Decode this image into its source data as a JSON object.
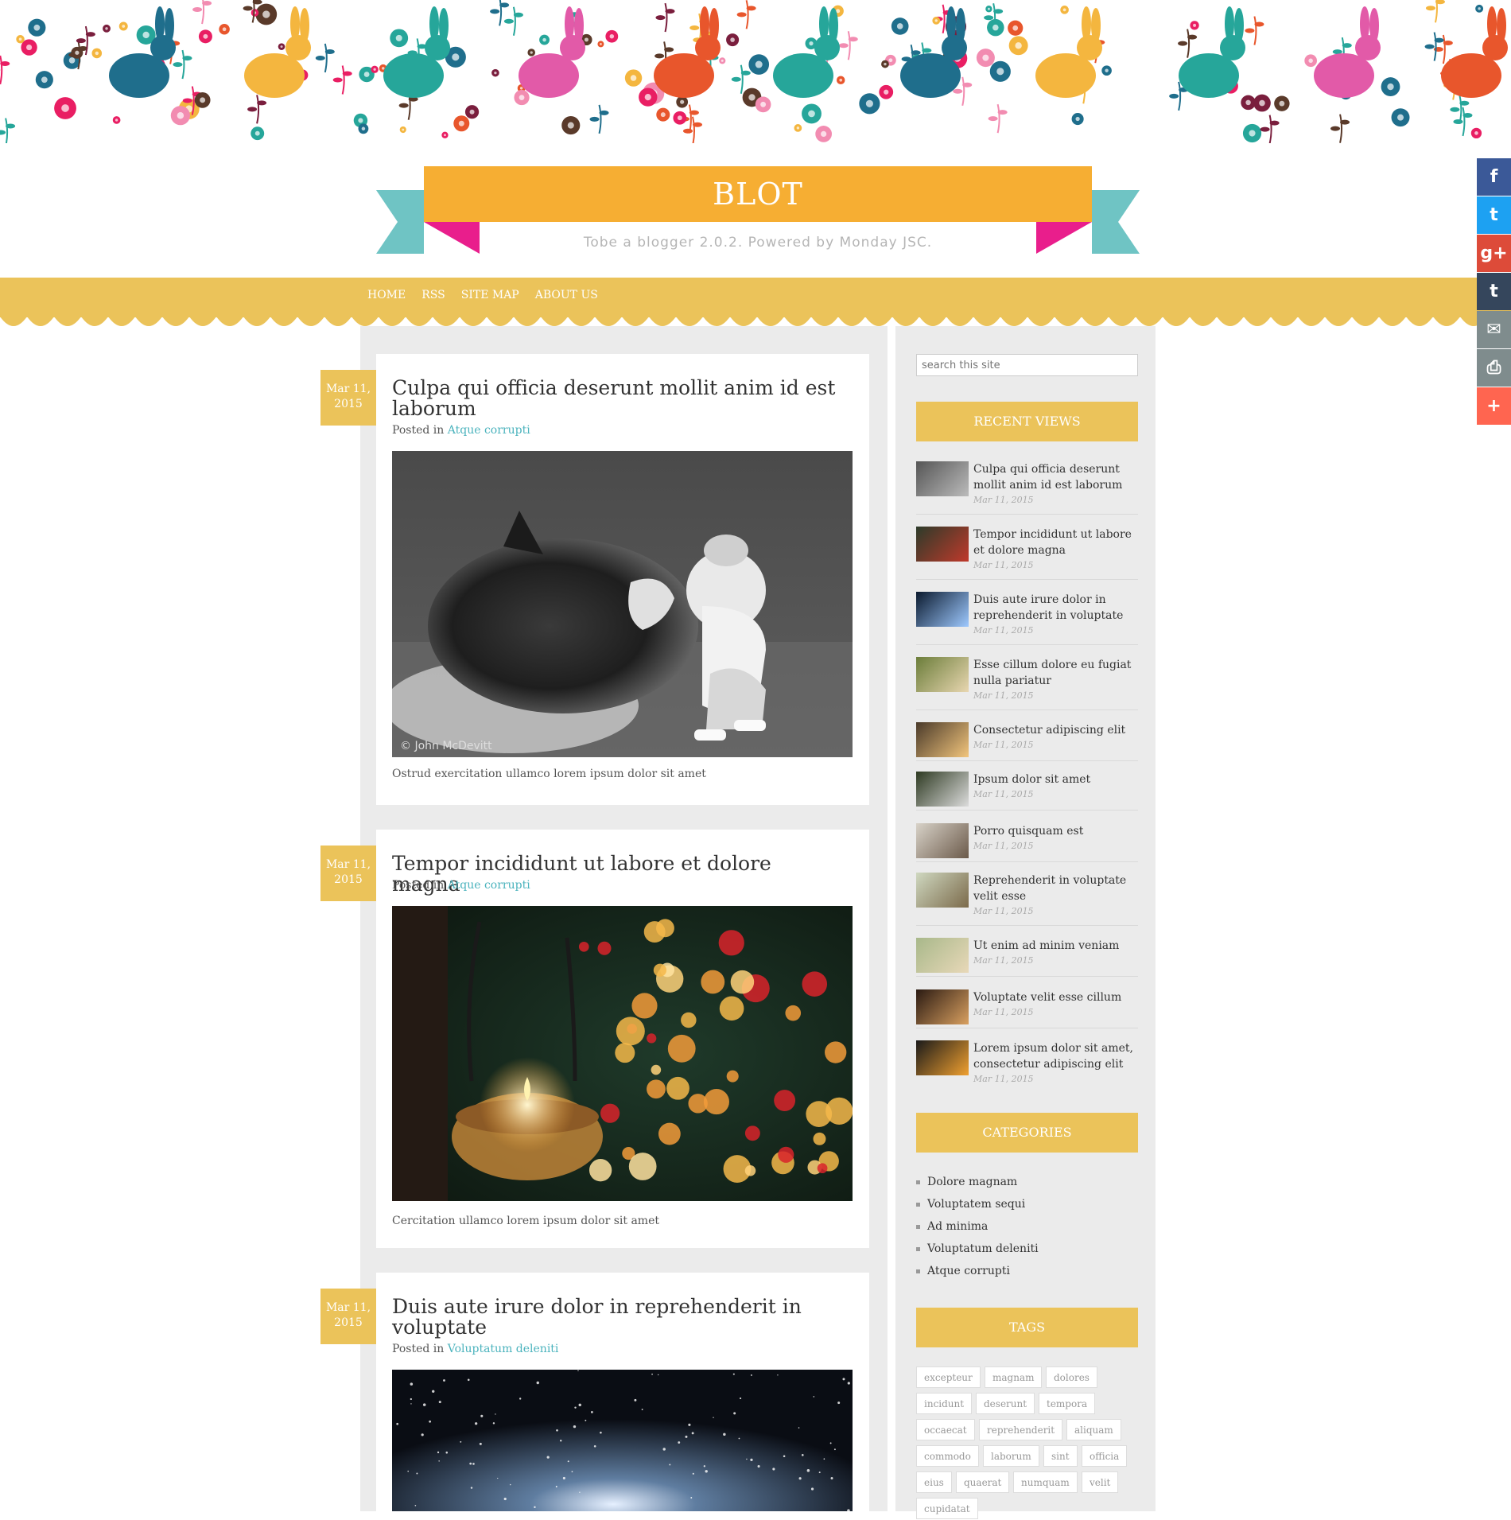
{
  "site": {
    "title": "BLOT",
    "tagline": "Tobe a blogger 2.0.2. Powered by Monday JSC."
  },
  "nav": {
    "items": [
      "HOME",
      "RSS",
      "SITE MAP",
      "ABOUT US"
    ]
  },
  "posts": [
    {
      "date_line1": "Mar 11,",
      "date_line2": "2015",
      "title": "Culpa qui officia deserunt mollit anim id est laborum",
      "posted_in": "Posted in",
      "category": "Atque corrupti",
      "image_credit": "© John McDevitt",
      "excerpt": "Ostrud exercitation ullamco lorem ipsum dolor sit amet"
    },
    {
      "date_line1": "Mar 11,",
      "date_line2": "2015",
      "title": "Tempor incididunt ut labore et dolore magna",
      "posted_in": "Posted in",
      "category": "Atque corrupti",
      "excerpt": "Cercitation ullamco lorem ipsum dolor sit amet"
    },
    {
      "date_line1": "Mar 11,",
      "date_line2": "2015",
      "title": "Duis aute irure dolor in reprehenderit in voluptate",
      "posted_in": "Posted in",
      "category": "Voluptatum deleniti"
    }
  ],
  "sidebar": {
    "search_placeholder": "search this site",
    "recent_title": "RECENT VIEWS",
    "recent": [
      {
        "title": "Culpa qui officia deserunt mollit anim id est laborum",
        "date": "Mar 11, 2015"
      },
      {
        "title": "Tempor incididunt ut labore et dolore magna",
        "date": "Mar 11, 2015"
      },
      {
        "title": "Duis aute irure dolor in reprehenderit in voluptate",
        "date": "Mar 11, 2015"
      },
      {
        "title": "Esse cillum dolore eu fugiat nulla pariatur",
        "date": "Mar 11, 2015"
      },
      {
        "title": "Consectetur adipiscing elit",
        "date": "Mar 11, 2015"
      },
      {
        "title": "Ipsum dolor sit amet",
        "date": "Mar 11, 2015"
      },
      {
        "title": "Porro quisquam est",
        "date": "Mar 11, 2015"
      },
      {
        "title": "Reprehenderit in voluptate velit esse",
        "date": "Mar 11, 2015"
      },
      {
        "title": "Ut enim ad minim veniam",
        "date": "Mar 11, 2015"
      },
      {
        "title": "Voluptate velit esse cillum",
        "date": "Mar 11, 2015"
      },
      {
        "title": "Lorem ipsum dolor sit amet, consectetur adipiscing elit",
        "date": "Mar 11, 2015"
      }
    ],
    "categories_title": "CATEGORIES",
    "categories": [
      "Dolore magnam",
      "Voluptatem sequi",
      "Ad minima",
      "Voluptatum deleniti",
      "Atque corrupti"
    ],
    "tags_title": "TAGS",
    "tags": [
      "excepteur",
      "magnam",
      "dolores",
      "incidunt",
      "deserunt",
      "tempora",
      "occaecat",
      "reprehenderit",
      "aliquam",
      "commodo",
      "laborum",
      "sint",
      "officia",
      "eius",
      "quaerat",
      "numquam",
      "velit",
      "cupidatat"
    ]
  },
  "share": [
    {
      "icon": "facebook-icon",
      "glyph": "f",
      "color": "#3b5998"
    },
    {
      "icon": "twitter-icon",
      "glyph": "t",
      "color": "#1da1f2"
    },
    {
      "icon": "googleplus-icon",
      "glyph": "g+",
      "color": "#dd4b39"
    },
    {
      "icon": "tumblr-icon",
      "glyph": "t",
      "color": "#35465c"
    },
    {
      "icon": "email-icon",
      "glyph": "✉",
      "color": "#7f8c8d"
    },
    {
      "icon": "print-icon",
      "glyph": "⎙",
      "color": "#7f8c8d"
    },
    {
      "icon": "more-icon",
      "glyph": "+",
      "color": "#ff6550"
    }
  ],
  "colors": {
    "accent": "#ebc35a",
    "ribbon": "#f6ae33",
    "ribbon_teal": "#6fc4c4",
    "ribbon_pink": "#e91e8c",
    "link": "#4bb3bd"
  }
}
